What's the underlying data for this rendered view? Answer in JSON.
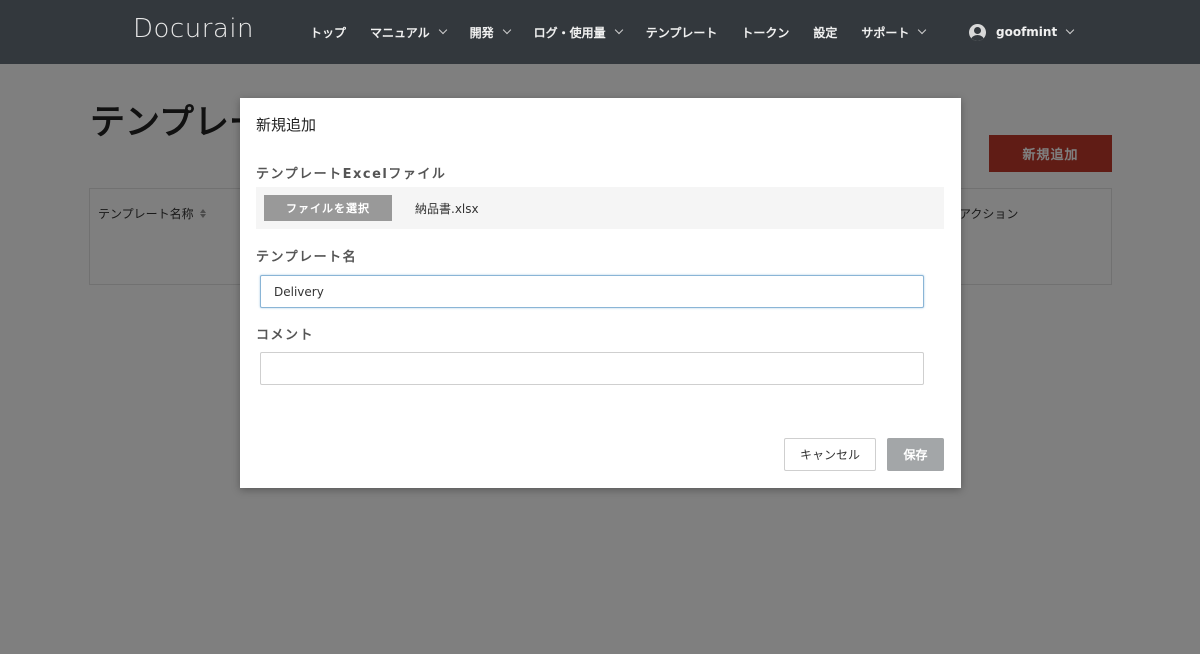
{
  "header": {
    "logo": "Docurain",
    "nav": [
      {
        "label": "トップ",
        "has_dropdown": false
      },
      {
        "label": "マニュアル",
        "has_dropdown": true
      },
      {
        "label": "開発",
        "has_dropdown": true
      },
      {
        "label": "ログ・使用量",
        "has_dropdown": true
      },
      {
        "label": "テンプレート",
        "has_dropdown": false
      },
      {
        "label": "トークン",
        "has_dropdown": false
      },
      {
        "label": "設定",
        "has_dropdown": false
      },
      {
        "label": "サポート",
        "has_dropdown": true
      }
    ],
    "user": {
      "name": "goofmint",
      "icon": "user-circle-icon"
    }
  },
  "page": {
    "title": "テンプレート",
    "add_button": "新規追加",
    "table": {
      "col_name": "テンプレート名称",
      "col_action": "アクション"
    }
  },
  "modal": {
    "title": "新規追加",
    "file_label": "テンプレートExcelファイル",
    "file_button": "ファイルを選択",
    "file_name": "納品書.xlsx",
    "name_label": "テンプレート名",
    "name_value": "Delivery",
    "comment_label": "コメント",
    "comment_value": "",
    "cancel": "キャンセル",
    "save": "保存"
  },
  "colors": {
    "header_bg": "#33383d",
    "accent_red": "#c0392b",
    "save_disabled": "#a3a6a8"
  }
}
